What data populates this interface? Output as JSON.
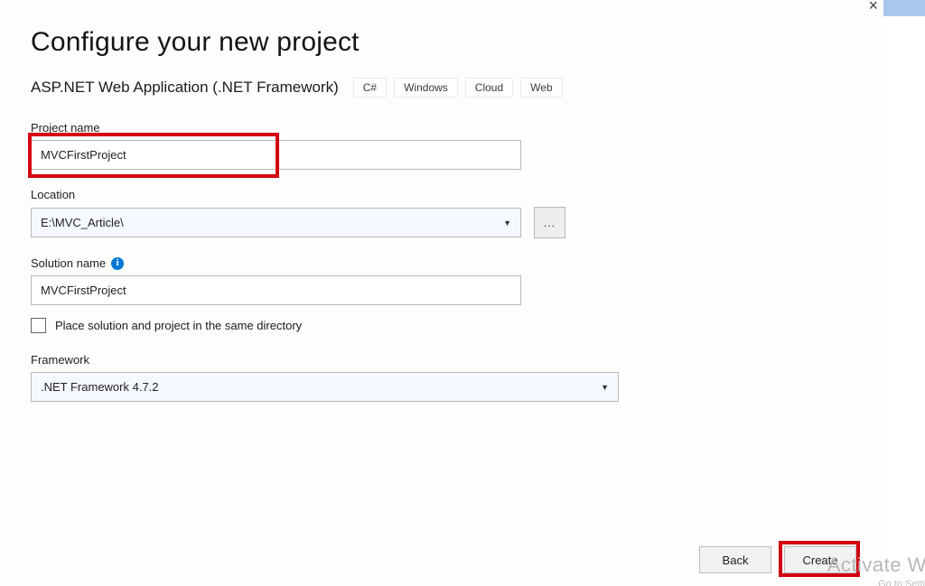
{
  "window": {
    "close_symbol": "×"
  },
  "title": "Configure your new project",
  "subtitle": "ASP.NET Web Application (.NET Framework)",
  "tags": [
    "C#",
    "Windows",
    "Cloud",
    "Web"
  ],
  "project_name": {
    "label": "Project name",
    "value": "MVCFirstProject"
  },
  "location": {
    "label": "Location",
    "value": "E:\\MVC_Article\\",
    "browse_label": "..."
  },
  "solution_name": {
    "label": "Solution name",
    "value": "MVCFirstProject"
  },
  "same_dir_checkbox": {
    "label": "Place solution and project in the same directory",
    "checked": false
  },
  "framework": {
    "label": "Framework",
    "value": ".NET Framework 4.7.2"
  },
  "buttons": {
    "back": "Back",
    "create": "Create"
  },
  "watermark": {
    "line1": "Activate Win",
    "line2": "Go to Settings to"
  }
}
